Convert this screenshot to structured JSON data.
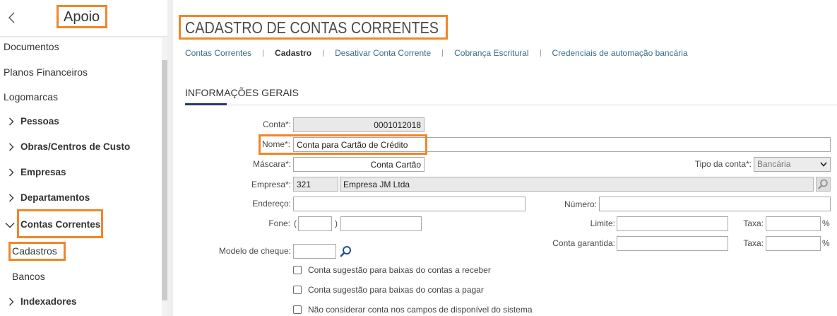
{
  "colors": {
    "highlight": "#f0862a",
    "tab_link": "#3a6b8d",
    "tab_active": "#333333",
    "section_underline": "#27357a",
    "search_icon": "#1f4f9a"
  },
  "sidebar": {
    "back_icon": "chevron-left-icon",
    "title": "Apoio",
    "items": [
      {
        "label": "Documentos"
      },
      {
        "label": "Planos Financeiros"
      },
      {
        "label": "Logomarcas"
      },
      {
        "label": "Pessoas",
        "icon": "chevron-right-icon",
        "expanded": false
      },
      {
        "label": "Obras/Centros de Custo",
        "icon": "chevron-right-icon",
        "expanded": false
      },
      {
        "label": "Empresas",
        "icon": "chevron-right-icon",
        "expanded": false
      },
      {
        "label": "Departamentos",
        "icon": "chevron-right-icon",
        "expanded": false
      },
      {
        "label": "Contas Correntes",
        "icon": "chevron-down-icon",
        "expanded": true
      },
      {
        "label": "Cadastros",
        "selected": true
      },
      {
        "label": "Bancos"
      },
      {
        "label": "Indexadores",
        "icon": "chevron-right-icon",
        "expanded": false
      }
    ]
  },
  "page": {
    "title": "CADASTRO DE CONTAS CORRENTES"
  },
  "tabs": [
    {
      "label": "Contas Correntes",
      "active": false
    },
    {
      "label": "Cadastro",
      "active": true
    },
    {
      "label": "Desativar Conta Corrente",
      "active": false
    },
    {
      "label": "Cobrança Escritural",
      "active": false
    },
    {
      "label": "Credenciais de automação bancária",
      "active": false
    }
  ],
  "section": {
    "title": "INFORMAÇÕES GERAIS"
  },
  "form": {
    "conta": {
      "label": "Conta*:",
      "value": "0001012018"
    },
    "nome": {
      "label": "Nome*:",
      "value": "Conta para Cartão de Crédito"
    },
    "mascara": {
      "label": "Máscara*:",
      "value": "Conta Cartão"
    },
    "tipo_conta": {
      "label": "Tipo da conta*:",
      "selected": "Bancária"
    },
    "empresa": {
      "label": "Empresa*:",
      "code": "321",
      "name": "Empresa JM Ltda",
      "search_icon": "search-icon"
    },
    "endereco": {
      "label": "Endereço:",
      "value": ""
    },
    "numero": {
      "label": "Número:",
      "value": ""
    },
    "fone": {
      "label": "Fone:",
      "open_paren": "(",
      "close_paren": ")",
      "ddd": "",
      "number": ""
    },
    "limite": {
      "label": "Limite:",
      "value": ""
    },
    "taxa_limite": {
      "label": "Taxa:",
      "value": "",
      "unit": "%"
    },
    "conta_garantida": {
      "label": "Conta garantida:",
      "value": ""
    },
    "taxa_garantida": {
      "label": "Taxa:",
      "value": "",
      "unit": "%"
    },
    "modelo_cheque": {
      "label": "Modelo de cheque:",
      "value": "",
      "search_icon": "search-icon"
    },
    "checkboxes": [
      {
        "label": "Conta sugestão para baixas do contas a receber",
        "checked": false
      },
      {
        "label": "Conta sugestão para baixas do contas a pagar",
        "checked": false
      },
      {
        "label": "Não considerar conta nos campos de disponível do sistema",
        "checked": false
      }
    ]
  }
}
